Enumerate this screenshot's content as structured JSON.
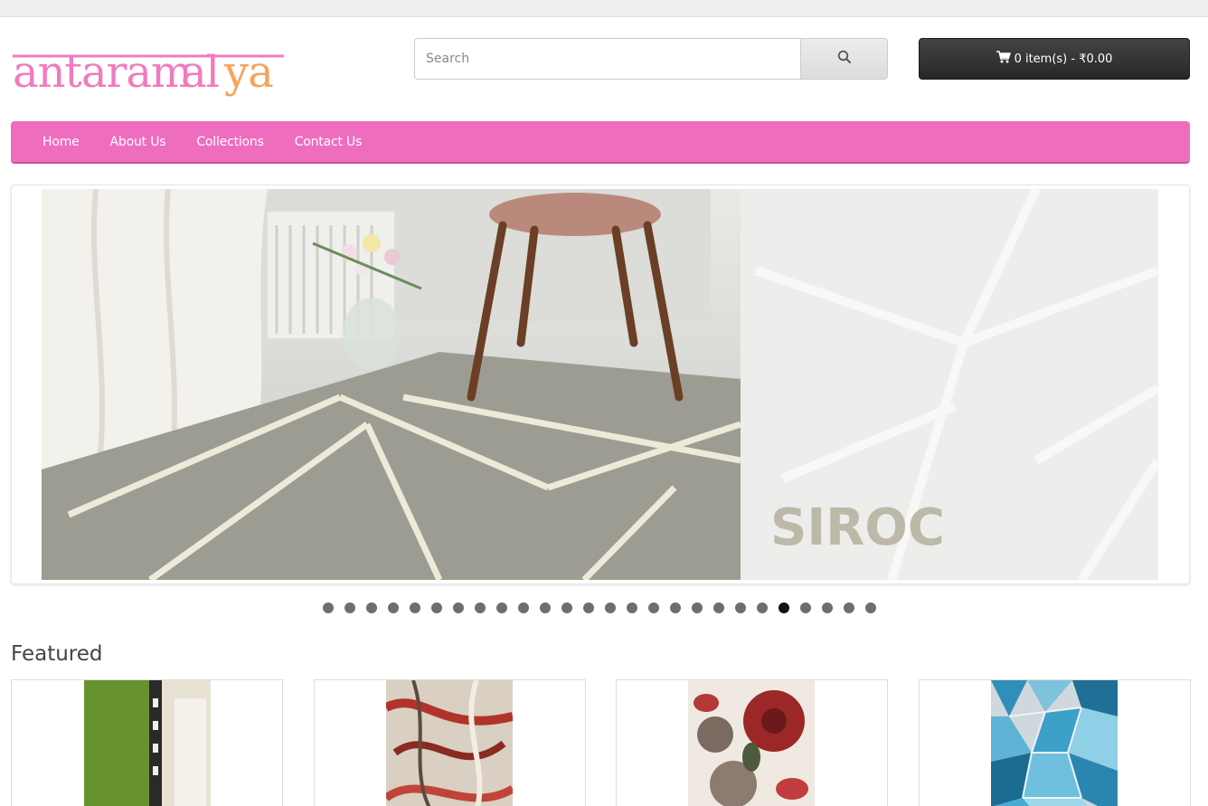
{
  "logo": {
    "text": "antaramalya",
    "colors": {
      "primary": "#f07bbf",
      "accent": "#f7a35c"
    }
  },
  "search": {
    "placeholder": "Search",
    "button_icon": "search-icon"
  },
  "cart": {
    "icon": "shopping-cart-icon",
    "label": "0 item(s) - ₹0.00"
  },
  "nav": {
    "background": "#ee6dbf",
    "items": [
      {
        "label": "Home"
      },
      {
        "label": "About Us"
      },
      {
        "label": "Collections"
      },
      {
        "label": "Contact Us"
      }
    ]
  },
  "slider": {
    "watermark": "SIROC",
    "dot_count": 26,
    "active_index": 21
  },
  "featured": {
    "title": "Featured",
    "products": [
      {
        "image": "green-grass-wall-rug"
      },
      {
        "image": "red-marble-abstract-rug"
      },
      {
        "image": "red-floral-rug"
      },
      {
        "image": "blue-geometric-glass-rug"
      }
    ]
  }
}
